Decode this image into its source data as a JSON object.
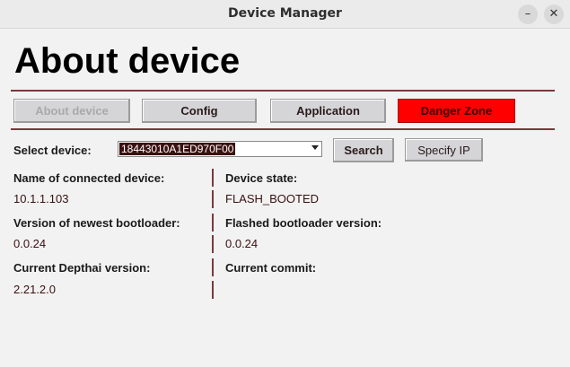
{
  "window": {
    "title": "Device Manager",
    "minimize_glyph": "–",
    "close_glyph": "✕"
  },
  "heading": "About device",
  "tabs": [
    {
      "label": "About device",
      "state": "disabled"
    },
    {
      "label": "Config",
      "state": "normal"
    },
    {
      "label": "Application",
      "state": "normal"
    },
    {
      "label": "Danger Zone",
      "state": "danger",
      "color": "#ff0000"
    }
  ],
  "device_select": {
    "label": "Select device:",
    "value": "18443010A1ED970F00",
    "search_label": "Search",
    "specify_ip_label": "Specify IP"
  },
  "info": {
    "name_label": "Name of connected device:",
    "name_value": "10.1.1.103",
    "state_label": "Device state:",
    "state_value": "FLASH_BOOTED",
    "bootloader_newest_label": "Version of newest bootloader:",
    "bootloader_newest_value": "0.0.24",
    "bootloader_flashed_label": "Flashed bootloader version:",
    "bootloader_flashed_value": "0.0.24",
    "depthai_label": "Current Depthai version:",
    "depthai_value": "2.21.2.0",
    "commit_label": "Current commit:",
    "commit_value": ""
  },
  "colors": {
    "accent_rule": "#7a3a3a",
    "danger": "#ff0000"
  }
}
